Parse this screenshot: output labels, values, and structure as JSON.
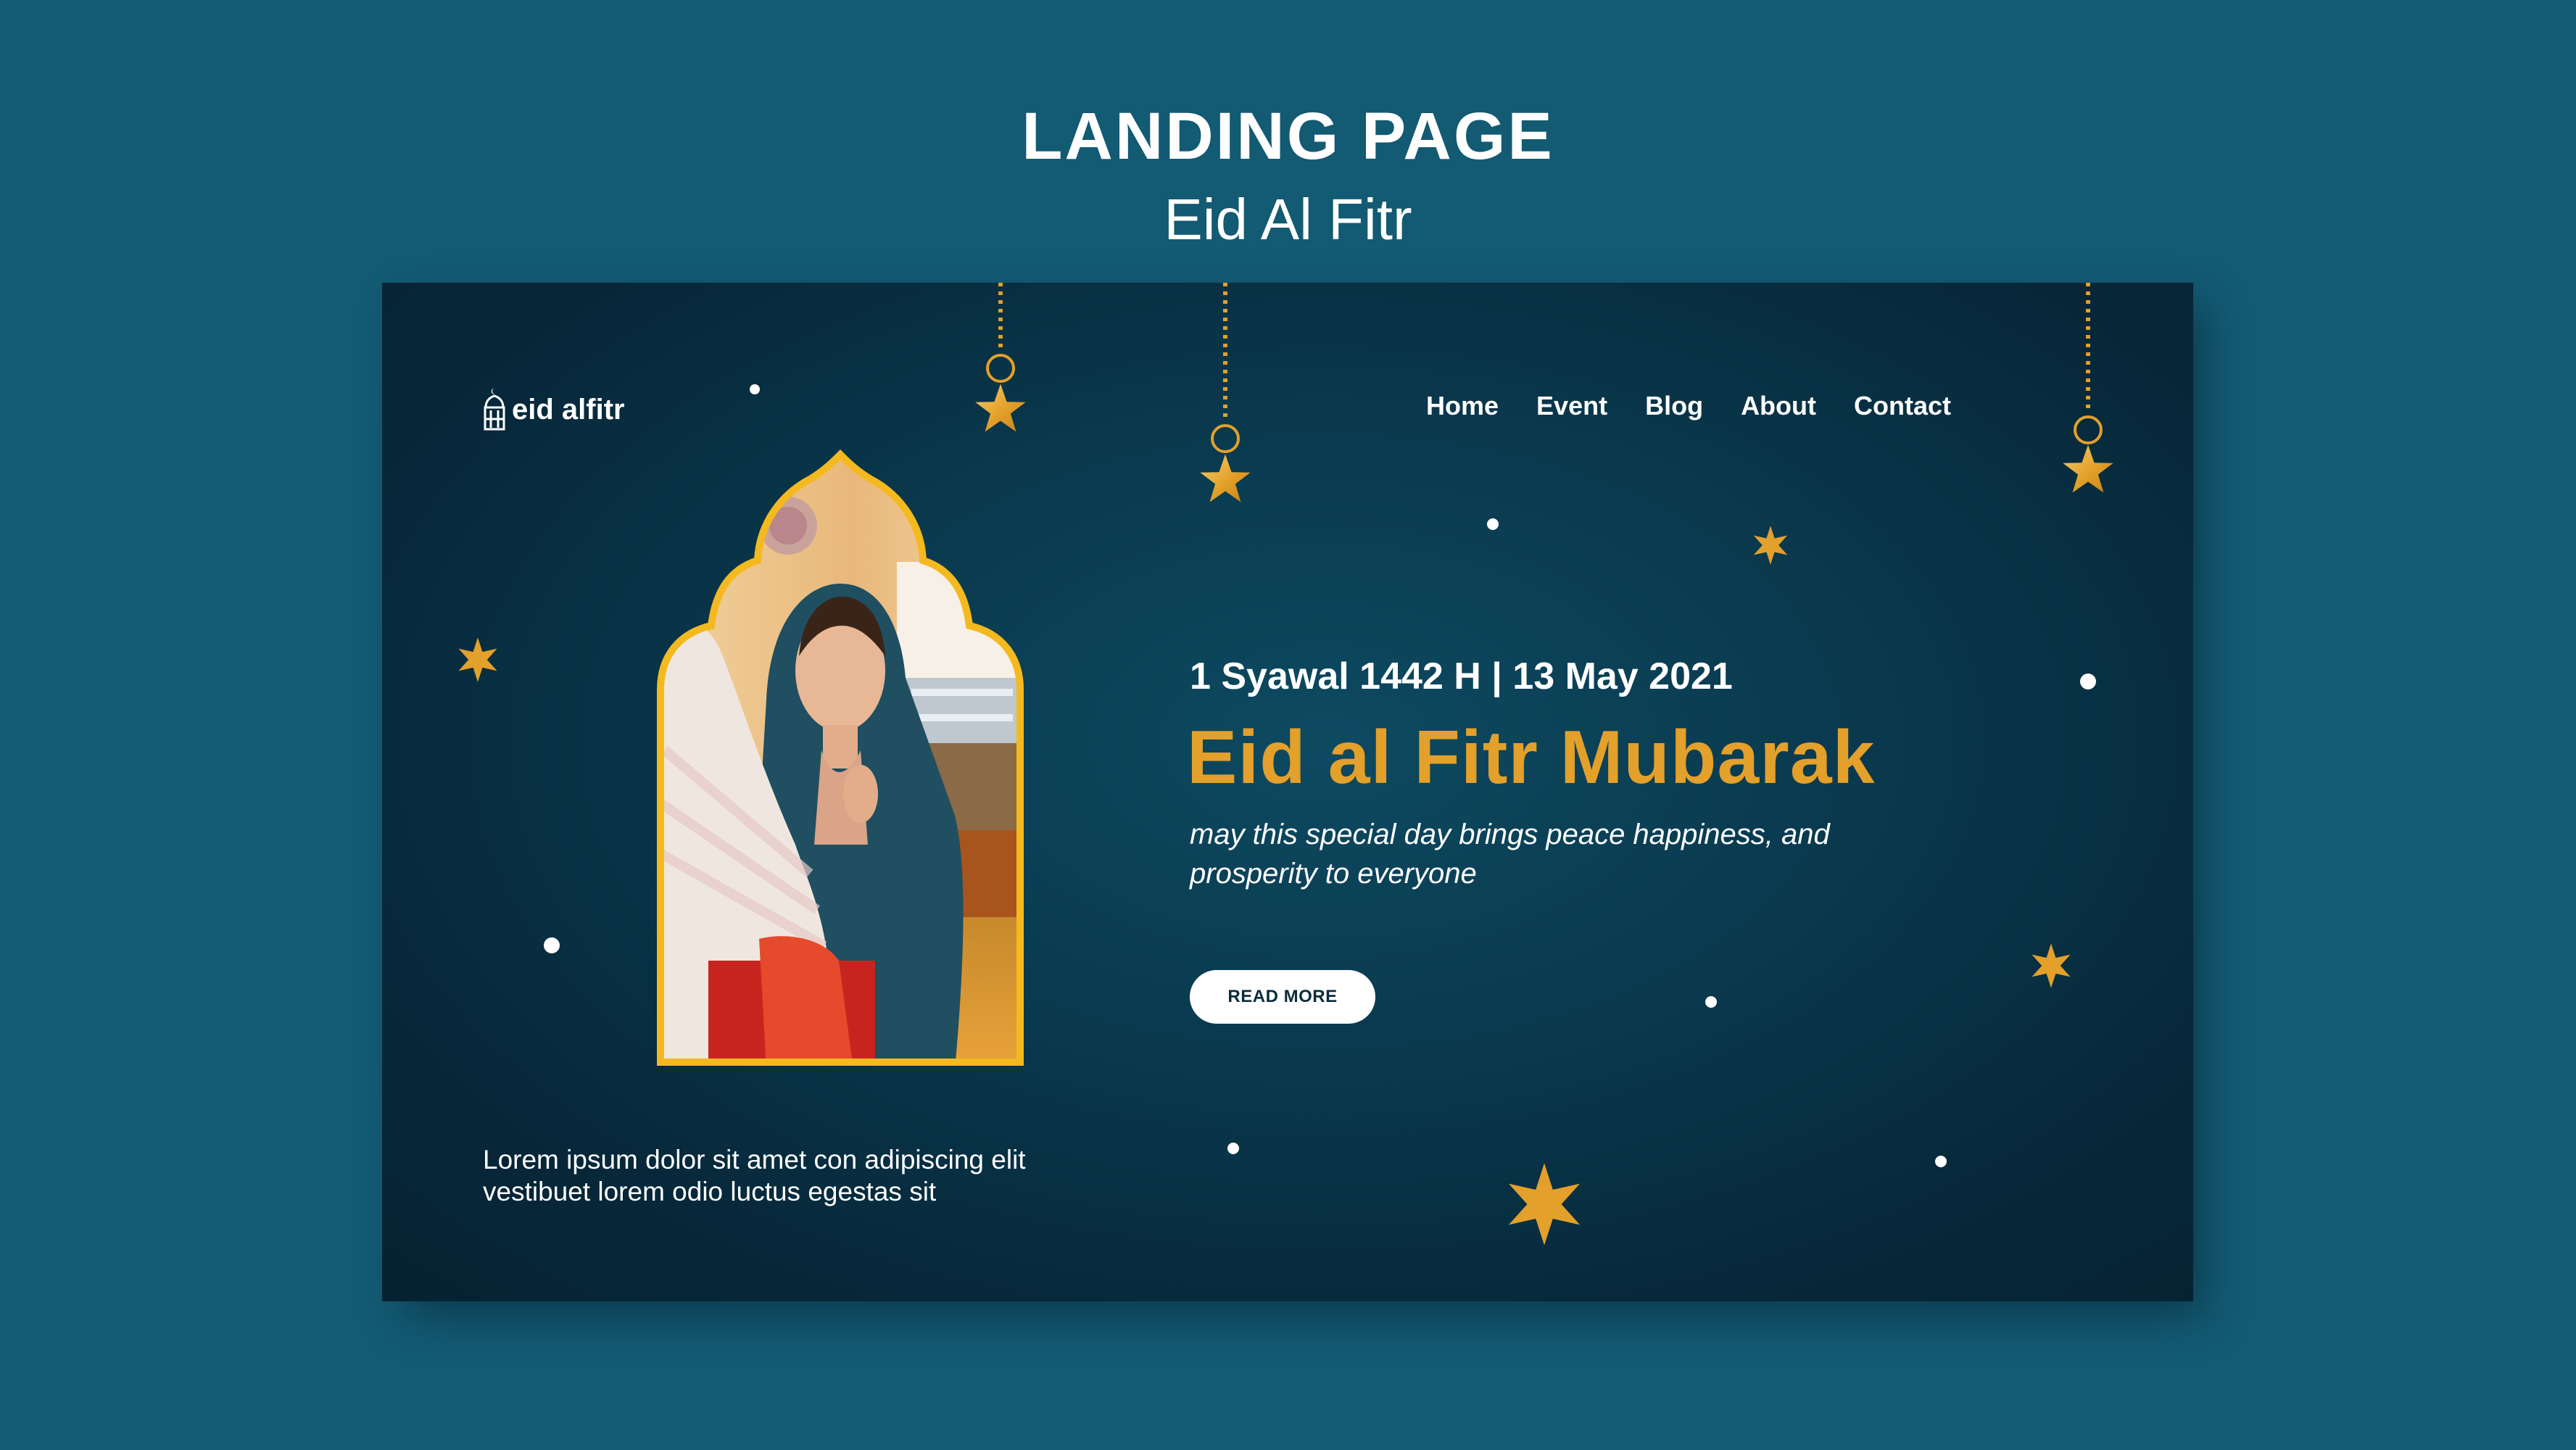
{
  "showcase": {
    "title": "LANDING PAGE",
    "subtitle": "Eid Al Fitr"
  },
  "site": {
    "logo_text": "eid alfitr",
    "logo_icon": "mosque-lantern-icon",
    "nav": [
      {
        "label": "Home"
      },
      {
        "label": "Event"
      },
      {
        "label": "Blog"
      },
      {
        "label": "About"
      },
      {
        "label": "Contact"
      }
    ]
  },
  "hero": {
    "date_line": "1 Syawal 1442 H | 13 May 2021",
    "headline": "Eid al Fitr Mubarak",
    "tagline": "may this special day brings peace happiness, and prosperity to everyone",
    "button_label": "READ MORE",
    "image": "woman-in-hijab-photo"
  },
  "footer": {
    "lorem": "Lorem ipsum dolor sit amet con adipiscing elit vestibuet lorem odio luctus egestas sit"
  },
  "colors": {
    "background": "#135a73",
    "page_dark": "#062232",
    "accent_gold": "#e3a02a",
    "white": "#ffffff"
  }
}
